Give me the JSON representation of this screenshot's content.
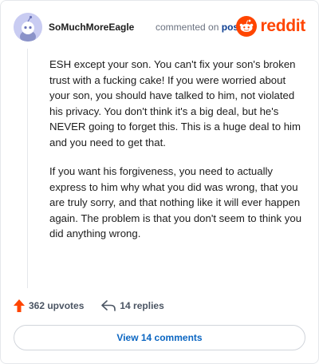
{
  "comment": {
    "username": "SoMuchMoreEagle",
    "action_text": "commented on",
    "target": "post",
    "paragraphs": [
      "ESH except your son. You can't fix your son's broken trust with a fucking cake! If you were worried about your son, you should have talked to him, not violated his privacy. You don't think it's a big deal, but he's NEVER going to forget this. This is a huge deal to him and you need to get that.",
      "If you want his forgiveness, you need to actually express to him why what you did was wrong, that you are truly sorry, and that nothing like it will ever happen again. The problem is that you don't seem to think you did anything wrong."
    ],
    "upvotes": "362 upvotes",
    "replies": "14 replies",
    "view_button": "View 14 comments"
  },
  "brand": {
    "name": "reddit",
    "color": "#ff4500"
  },
  "icons": {
    "avatar": "default-snoo-avatar-icon",
    "logo": "reddit-snoo-icon",
    "upvote": "upvote-arrow-icon",
    "reply": "reply-arrow-icon"
  },
  "colors": {
    "upvote": "#ff4500",
    "link": "#0b66c2",
    "avatar_bg": "#c9ccf2"
  }
}
